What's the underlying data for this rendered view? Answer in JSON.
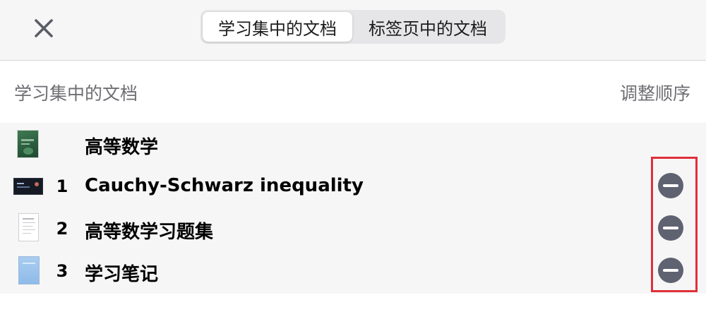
{
  "header": {
    "close_icon": "close-icon",
    "tabs": [
      {
        "label": "学习集中的文档",
        "active": true
      },
      {
        "label": "标签页中的文档",
        "active": false
      }
    ]
  },
  "section": {
    "title": "学习集中的文档",
    "reorder_label": "调整顺序"
  },
  "items": [
    {
      "index": "",
      "title": "高等数学",
      "thumbnail": "green-book-cover",
      "removable": false
    },
    {
      "index": "1",
      "title": "Cauchy-Schwarz inequality",
      "thumbnail": "dark-video-frame",
      "removable": true
    },
    {
      "index": "2",
      "title": "高等数学习题集",
      "thumbnail": "white-document-page",
      "removable": true
    },
    {
      "index": "3",
      "title": "学习笔记",
      "thumbnail": "blue-notebook",
      "removable": true
    }
  ],
  "colors": {
    "remove_button": "#5f6270",
    "highlight": "#e0303a",
    "secondary_text": "#6e6e73"
  }
}
